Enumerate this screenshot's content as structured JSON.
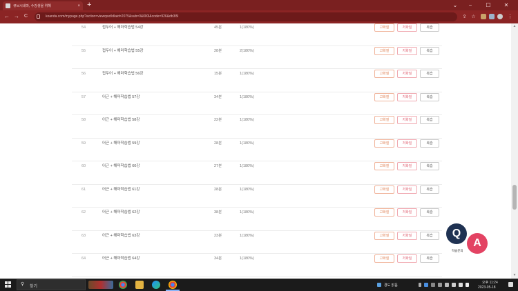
{
  "browser": {
    "tab_title": "큐브시네마, 수강생을 위해",
    "tab_close": "×",
    "new_tab": "+",
    "win_minimize": "−",
    "win_maximize": "☐",
    "win_close": "✕",
    "win_chevron": "⌄",
    "back": "←",
    "forward": "→",
    "reload": "C",
    "url": "koanda.com/mypage.php?action=viewqwclldlaid=2075&sub=0&l0l0l&code=926&db3l5l",
    "share_icon": "⇪",
    "star_icon": "☆",
    "menu_icon": "⋮"
  },
  "lessons": [
    {
      "num": "54",
      "title": "접두어 + 해마학습법 54강",
      "duration": "45분",
      "progress": "1(180%)",
      "btn1": "고화질",
      "btn2": "저화질",
      "btn3": "복습"
    },
    {
      "num": "55",
      "title": "접두어 + 해마학습법 55강",
      "duration": "28분",
      "progress": "2(180%)",
      "btn1": "고화질",
      "btn2": "저화질",
      "btn3": "복습"
    },
    {
      "num": "56",
      "title": "접두어 + 해마학습법 56강",
      "duration": "15분",
      "progress": "1(180%)",
      "btn1": "고화질",
      "btn2": "저화질",
      "btn3": "복습"
    },
    {
      "num": "57",
      "title": "어근 + 해마학습법 57강",
      "duration": "34분",
      "progress": "1(180%)",
      "btn1": "고화질",
      "btn2": "저화질",
      "btn3": "복습"
    },
    {
      "num": "58",
      "title": "어근 + 해마학습법 58강",
      "duration": "22분",
      "progress": "1(180%)",
      "btn1": "고화질",
      "btn2": "저화질",
      "btn3": "복습"
    },
    {
      "num": "59",
      "title": "어근 + 해마학습법 59강",
      "duration": "28분",
      "progress": "1(180%)",
      "btn1": "고화질",
      "btn2": "저화질",
      "btn3": "복습"
    },
    {
      "num": "60",
      "title": "어근 + 해마학습법 60강",
      "duration": "27분",
      "progress": "1(180%)",
      "btn1": "고화질",
      "btn2": "저화질",
      "btn3": "복습"
    },
    {
      "num": "61",
      "title": "어근 + 해마학습법 61강",
      "duration": "28분",
      "progress": "1(180%)",
      "btn1": "고화질",
      "btn2": "저화질",
      "btn3": "복습"
    },
    {
      "num": "62",
      "title": "어근 + 해마학습법 62강",
      "duration": "38분",
      "progress": "1(180%)",
      "btn1": "고화질",
      "btn2": "저화질",
      "btn3": "복습"
    },
    {
      "num": "63",
      "title": "어근 + 해마학습법 63강",
      "duration": "23분",
      "progress": "1(180%)",
      "btn1": "고화질",
      "btn2": "저화질",
      "btn3": "복습"
    },
    {
      "num": "64",
      "title": "어근 + 해마학습법 64강",
      "duration": "34분",
      "progress": "1(180%)",
      "btn1": "고화질",
      "btn2": "저화질",
      "btn3": "복습"
    }
  ],
  "qa_widget": {
    "q": "Q",
    "a": "A",
    "label": "학습문의"
  },
  "taskbar": {
    "search_icon": "⚲",
    "search_text": "찾기",
    "weather": "경도 맑음",
    "time": "오후 11:24",
    "date": "2023-05-18"
  },
  "colors": {
    "tab_bar": "#7a2020",
    "address_bar": "#8b2424",
    "btn_high": "#e0855a",
    "btn_low": "#e06878",
    "qa_q": "#1f3252",
    "qa_a": "#e34363"
  }
}
